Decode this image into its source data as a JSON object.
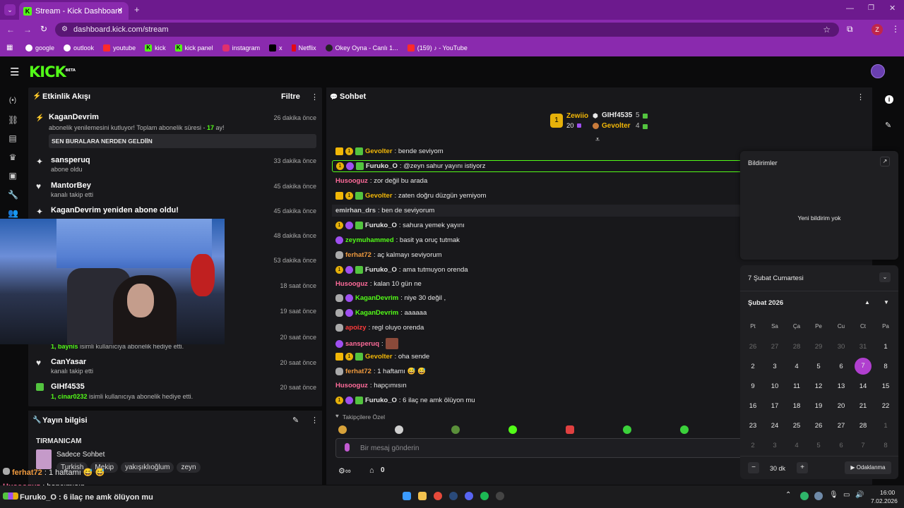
{
  "browser": {
    "tab_title": "Stream - Kick Dashboard",
    "url": "dashboard.kick.com/stream",
    "profile_initial": "Z",
    "bookmarks": [
      "google",
      "outlook",
      "youtube",
      "kick",
      "kick panel",
      "instagram",
      "x",
      "Netflix",
      "Okey Oyna - Canlı 1...",
      "(159) ♪ - YouTube"
    ]
  },
  "app": {
    "logo": "KICK",
    "logo_badge": "BETA"
  },
  "events": {
    "title": "Etkinlik Akışı",
    "filter": "Filtre",
    "items": [
      {
        "name": "KaganDevrim",
        "sub": "abonelik yenilemesini kutluyor! Toplam abonelik süresi - ",
        "sub_hl": "17",
        "sub_end": " ay!",
        "time": "26 dakika önce",
        "note": "SEN BURALARA NERDEN GELDİİN"
      },
      {
        "name": "sansperuq",
        "sub": "abone oldu",
        "time": "33 dakika önce"
      },
      {
        "name": "MantorBey",
        "sub": "kanalı takip etti",
        "time": "45 dakika önce"
      },
      {
        "name": "KaganDevrim yeniden abone oldu!",
        "time": "45 dakika önce"
      },
      {
        "time": "48 dakika önce"
      },
      {
        "time": "53 dakika önce"
      },
      {
        "time": "18 saat önce"
      },
      {
        "time": "19 saat önce"
      },
      {
        "sub_hl": "1, baynis",
        "sub": " isimli kullanıcıya abonelik hediye etti.",
        "time": "20 saat önce"
      },
      {
        "name": "CanYasar",
        "sub": "kanalı takip etti",
        "time": "20 saat önce"
      },
      {
        "name": "GIHf4535",
        "sub_hl": "1, cinar0232",
        "sub": " isimli kullanıcıya abonelik hediye etti.",
        "time": "20 saat önce"
      }
    ]
  },
  "stream_info": {
    "title": "Yayın bilgisi",
    "stream_title": "TIRMANICAM",
    "category": "Sadece Sohbet",
    "tags": [
      "Turkish",
      "Mekip",
      "yakışıklıoğlum",
      "zeyn"
    ]
  },
  "chat": {
    "title": "Sohbet",
    "leaderboard": [
      {
        "rank": "1",
        "name": "Zewiio",
        "count": "20"
      },
      {
        "name": "GIHf4535",
        "count": "5"
      },
      {
        "name": "Gevolter",
        "count": "4"
      }
    ],
    "messages": [
      {
        "user": "Gevolter",
        "text": ": bende seviyom",
        "color": "#f2b707"
      },
      {
        "user": "Furuko_O",
        "text": ": @zeyn sahur yayını istiyorz",
        "color": "#e8e8e8"
      },
      {
        "user": "Husooguz",
        "text": ": zor değil bu arada",
        "color": "#ff6b9a"
      },
      {
        "user": "Gevolter",
        "text": ": zaten doğru düzgün yemiyom",
        "color": "#f2b707"
      },
      {
        "user": "emirhan_drs",
        "text": ": ben de seviyorum",
        "color": "#cfcfcf"
      },
      {
        "user": "Furuko_O",
        "text": ": sahura yemek yayını",
        "color": "#e8e8e8"
      },
      {
        "user": "zeymuhammed",
        "text": ": basit ya oruç tutmak",
        "color": "#53fc18"
      },
      {
        "user": "ferhat72",
        "text": ": aç kalmayı seviyorum",
        "color": "#f09a3e"
      },
      {
        "user": "Furuko_O",
        "text": ": ama tutmuyon orenda",
        "color": "#e8e8e8"
      },
      {
        "user": "Husooguz",
        "text": ": kalan 10 gün ne",
        "color": "#ff6b9a"
      },
      {
        "user": "KaganDevrim",
        "text": ": niye 30 değil ,",
        "color": "#53fc18"
      },
      {
        "user": "KaganDevrim",
        "text": ": aaaaaa",
        "color": "#53fc18"
      },
      {
        "user": "apoizy",
        "text": ": regl oluyo orenda",
        "color": "#ff3b3b"
      },
      {
        "user": "sansperuq",
        "text": ":",
        "color": "#ff6b9a"
      },
      {
        "user": "Gevolter",
        "text": ": oha sende",
        "color": "#f2b707"
      },
      {
        "user": "ferhat72",
        "text": ": 1 haftamı 😅 😅",
        "color": "#f09a3e"
      },
      {
        "user": "Husooguz",
        "text": ": hapçımısın",
        "color": "#ff6b9a"
      },
      {
        "user": "Furuko_O",
        "text": ": 6 ilaç ne amk ölüyon mu",
        "color": "#e8e8e8"
      }
    ],
    "followers_only": "Takipçilere Özel",
    "placeholder": "Bir mesaj gönderin",
    "counter": "0"
  },
  "notifications": {
    "title": "Bildirimler",
    "empty": "Yeni bildirim yok"
  },
  "calendar": {
    "date_label": "7 Şubat Cumartesi",
    "month_label": "Şubat 2026",
    "weekdays": [
      "Pt",
      "Sa",
      "Ça",
      "Pe",
      "Cu",
      "Ct",
      "Pa"
    ],
    "days": [
      "26",
      "27",
      "28",
      "29",
      "30",
      "31",
      "1",
      "2",
      "3",
      "4",
      "5",
      "6",
      "7",
      "8",
      "9",
      "10",
      "11",
      "12",
      "13",
      "14",
      "15",
      "16",
      "17",
      "18",
      "19",
      "20",
      "21",
      "22",
      "23",
      "24",
      "25",
      "26",
      "27",
      "28",
      "1",
      "2",
      "3",
      "4",
      "5",
      "6",
      "7",
      "8"
    ],
    "selected": "7",
    "focus_minutes": "30 dk",
    "focus_button": "Odaklanma"
  },
  "overlay": {
    "line1_user": "ferhat72",
    "line1_text": " : 1 haftamı 😅 😅",
    "line2_user": "Husooguz",
    "line2_text": " : hapçımısın",
    "line3_user": "Furuko_O",
    "line3_text": " : 6 ilaç ne amk ölüyon mu"
  },
  "taskbar": {
    "time": "16:00",
    "date": "7.02.2026"
  }
}
